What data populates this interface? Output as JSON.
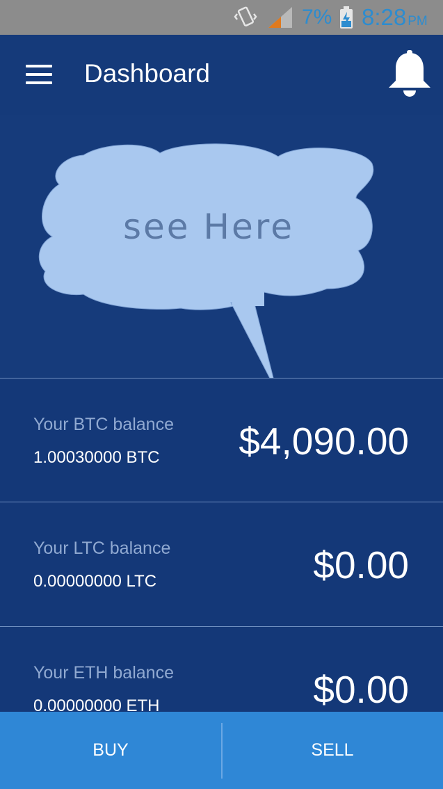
{
  "status_bar": {
    "battery": "7%",
    "time": "8:28",
    "ampm": "PM"
  },
  "app_bar": {
    "title": "Dashboard"
  },
  "tooltip": {
    "text": "see Here"
  },
  "balances": [
    {
      "label": "Your BTC balance",
      "amount": "1.00030000 BTC",
      "usd": "$4,090.00"
    },
    {
      "label": "Your LTC balance",
      "amount": "0.00000000 LTC",
      "usd": "$0.00"
    },
    {
      "label": "Your ETH balance",
      "amount": "0.00000000 ETH",
      "usd": "$0.00"
    }
  ],
  "actions": {
    "buy": "BUY",
    "sell": "SELL"
  },
  "colors": {
    "status_text": "#2d8ccf",
    "background": "#153a7a",
    "bottom_bar": "#2f87d6",
    "bubble": "#a9c8ef"
  }
}
